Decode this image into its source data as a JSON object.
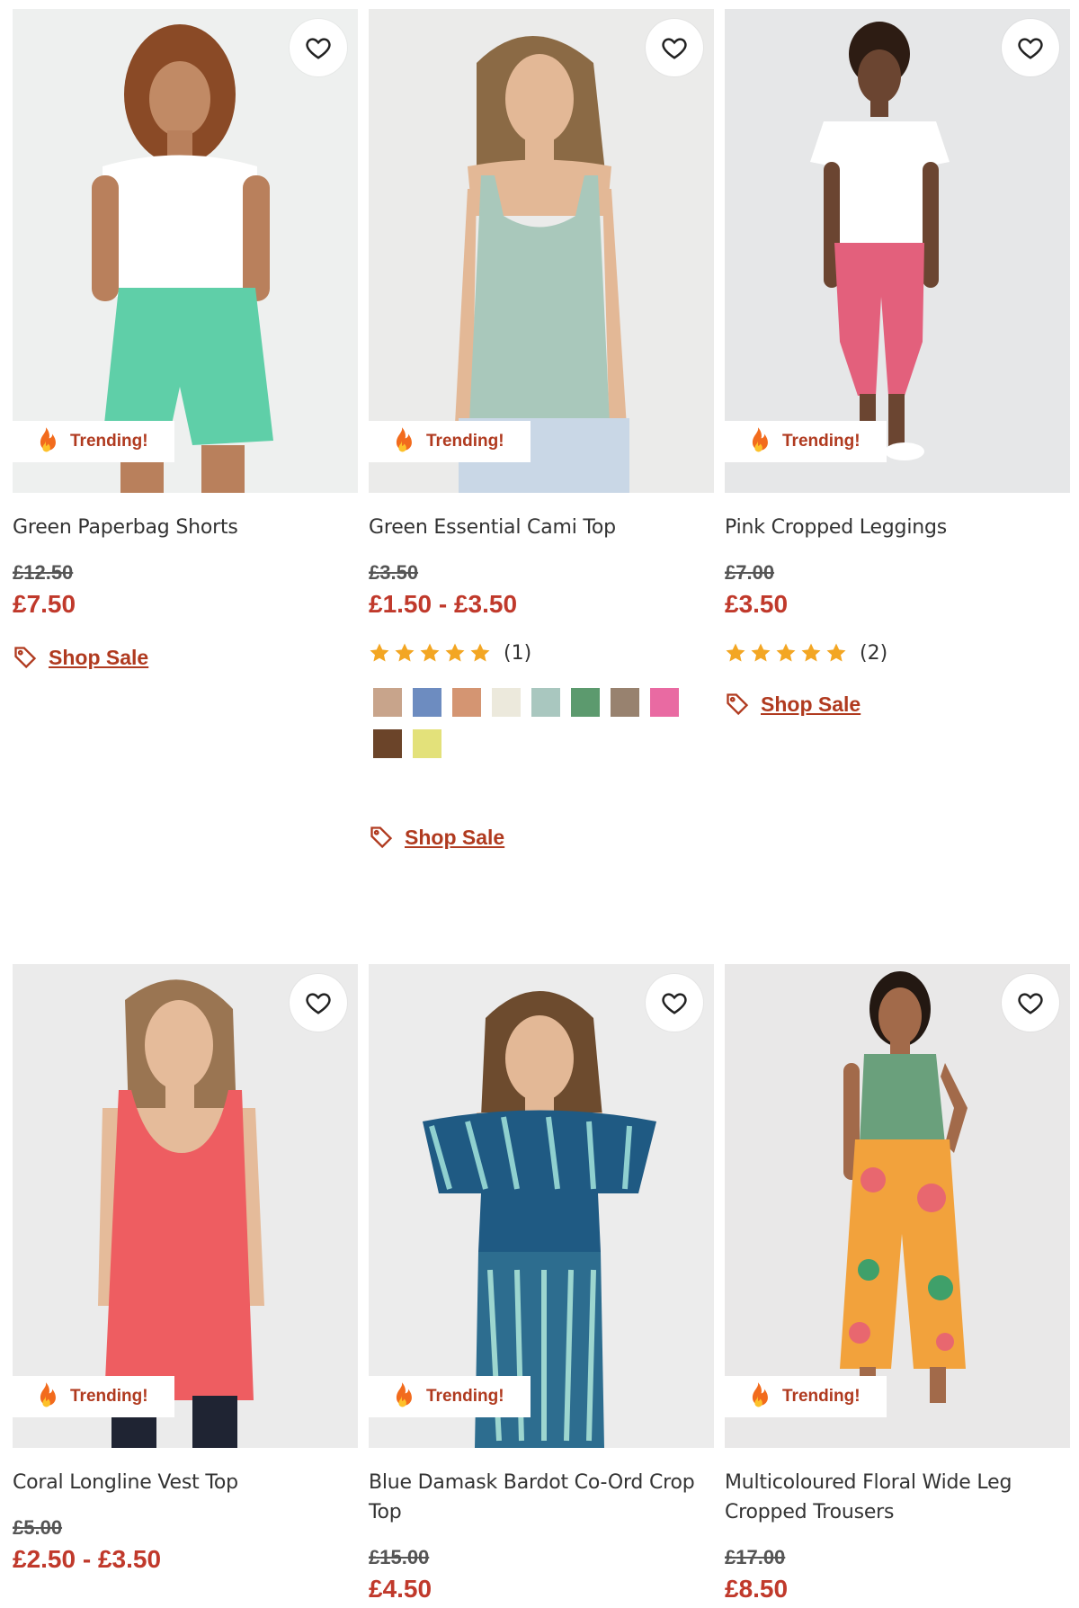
{
  "common": {
    "badge_label": "Trending!",
    "shop_sale_label": "Shop Sale"
  },
  "colors": {
    "sale_price": "#c0392b",
    "badge_text": "#b03a1f",
    "star": "#f3a623"
  },
  "products": [
    {
      "name": "Green Paperbag Shorts",
      "was_price": "£12.50",
      "now_price": "£7.50",
      "image": {
        "bg": "#eef0ef",
        "top": "#ffffff",
        "bottom": "#5fcfa8",
        "skin": "#b9805c",
        "hair": "#8a4a26"
      }
    },
    {
      "name": "Green Essential Cami Top",
      "was_price": "£3.50",
      "now_price": "£1.50 - £3.50",
      "rating_count": "(1)",
      "swatches": [
        "#c8a48b",
        "#6d8cc0",
        "#d49572",
        "#ece9dc",
        "#a9c7bf",
        "#5c9a6e",
        "#98826f",
        "#e96aa2",
        "#6b4429",
        "#e3e17a"
      ],
      "image": {
        "bg": "#ebebea",
        "top": "#a9c8bb",
        "bottom": "#c9d7e6",
        "skin": "#e3b896",
        "hair": "#8b6a45"
      }
    },
    {
      "name": "Pink Cropped Leggings",
      "was_price": "£7.00",
      "now_price": "£3.50",
      "rating_count": "(2)",
      "image": {
        "bg": "#e6e7e8",
        "top": "#ffffff",
        "bottom": "#e3607c",
        "skin": "#6b4531",
        "hair": "#2d1c13"
      }
    },
    {
      "name": "Coral Longline Vest Top",
      "was_price": "£5.00",
      "now_price": "£2.50 - £3.50",
      "image": {
        "bg": "#ebebeb",
        "top": "#ee5d61",
        "bottom": "#1f2433",
        "skin": "#e5bb9a",
        "hair": "#9a7552"
      }
    },
    {
      "name": "Blue Damask Bardot Co-Ord Crop Top",
      "was_price": "£15.00",
      "now_price": "£4.50",
      "image": {
        "bg": "#ececec",
        "top": "#1f5a83",
        "bottom": "#2d6d8f",
        "skin": "#e3b896",
        "hair": "#6d4b2e"
      }
    },
    {
      "name": "Multicoloured Floral Wide Leg Cropped Trousers",
      "was_price": "£17.00",
      "now_price": "£8.50",
      "image": {
        "bg": "#e9e8e8",
        "top": "#6aa07c",
        "bottom": "#f2a23c",
        "skin": "#a26a4a",
        "hair": "#231812"
      }
    }
  ]
}
